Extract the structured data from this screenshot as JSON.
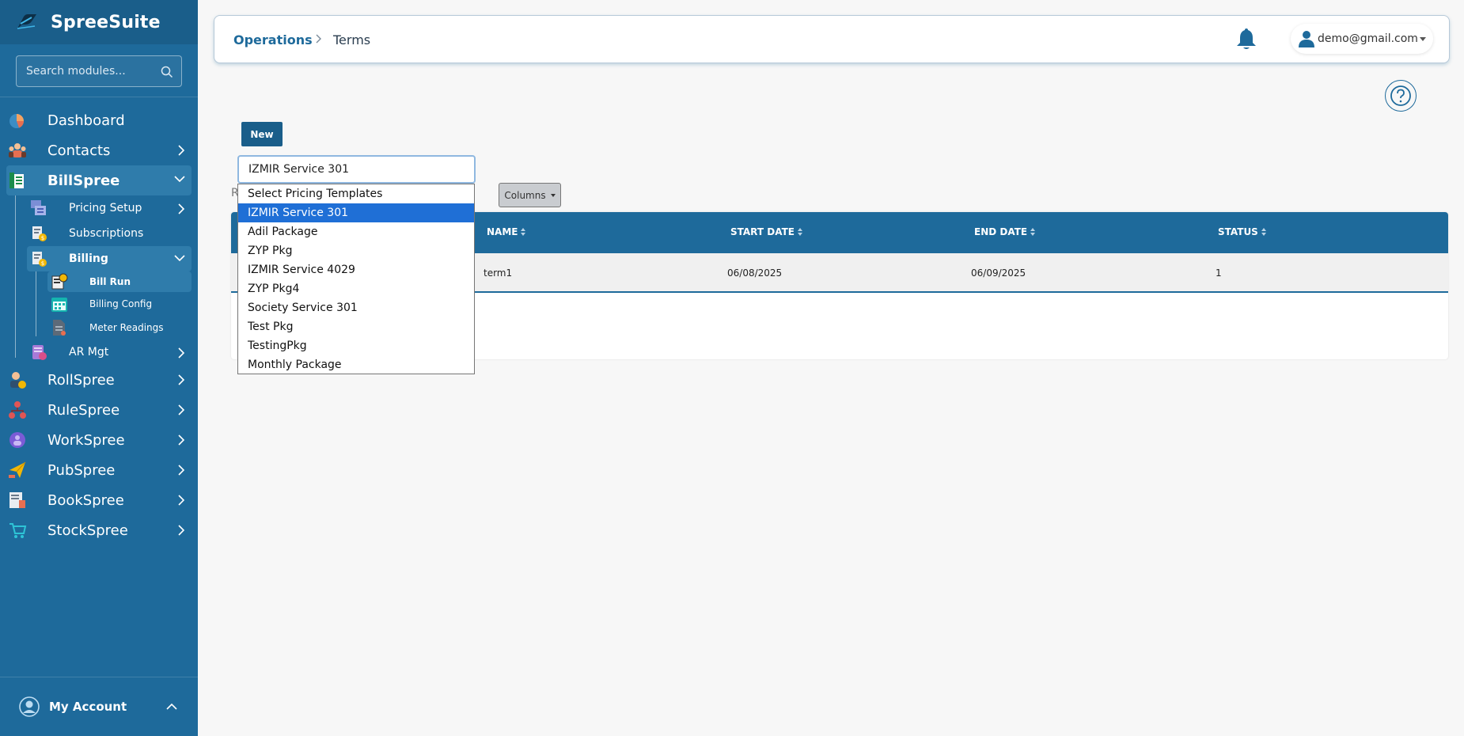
{
  "app": {
    "name": "SpreeSuite"
  },
  "search": {
    "placeholder": "Search modules..."
  },
  "nav": {
    "dashboard": "Dashboard",
    "contacts": "Contacts",
    "billspree": "BillSpree",
    "pricing_setup": "Pricing Setup",
    "subscriptions": "Subscriptions",
    "billing": "Billing",
    "bill_run": "Bill Run",
    "billing_config": "Billing Config",
    "meter_readings": "Meter Readings",
    "ar_mgt": "AR Mgt",
    "rollspree": "RollSpree",
    "rulespree": "RuleSpree",
    "workspree": "WorkSpree",
    "pubspree": "PubSpree",
    "bookspree": "BookSpree",
    "stockspree": "StockSpree"
  },
  "account": {
    "label": "My Account"
  },
  "header": {
    "breadcrumb_parent": "Operations",
    "breadcrumb_current": "Terms",
    "user_email": "demo@gmail.com"
  },
  "toolbar": {
    "new_label": "New",
    "columns_label": "Columns",
    "partial_label": "R"
  },
  "template_select": {
    "selected": "IZMIR Service 301",
    "options": [
      "Select Pricing Templates",
      "IZMIR Service 301",
      "Adil Package",
      "ZYP Pkg",
      "IZMIR Service 4029",
      "ZYP Pkg4",
      "Society Service 301",
      "Test Pkg",
      "TestingPkg",
      "Monthly Package"
    ]
  },
  "table": {
    "columns": [
      "NAME",
      "START DATE",
      "END DATE",
      "STATUS"
    ],
    "rows": [
      {
        "name": "term1",
        "start_date": "06/08/2025",
        "end_date": "06/09/2025",
        "status": "1"
      }
    ]
  },
  "colors": {
    "sidebar": "#1e6a9b",
    "brand_bar": "#1a5e8a",
    "active_item": "#2f7cab",
    "table_header": "#1e6a9b",
    "option_highlight": "#1f6fd6"
  },
  "icons": {
    "brand": "spreesuite-logo-icon",
    "search": "search-icon",
    "bell": "bell-icon",
    "user": "user-icon",
    "help": "question-circle-icon"
  }
}
